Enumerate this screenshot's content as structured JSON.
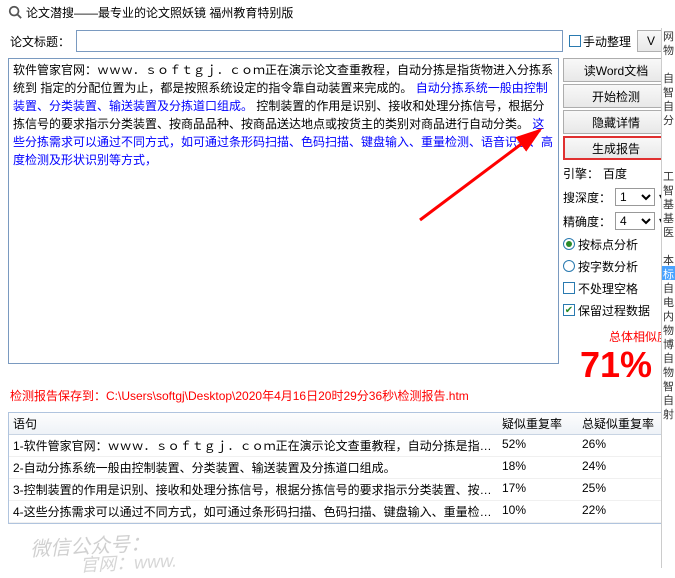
{
  "window": {
    "title": "论文潜搜——最专业的论文照妖镜 福州教育特别版"
  },
  "top": {
    "title_label": "论文标题：",
    "manual_sort": "手动整理",
    "btn_v": "V"
  },
  "content": {
    "line1": "软件管家官网：ｗｗｗ．ｓｏｆｔｇｊ．ｃｏｍ正在演示论文查重教程，自动分拣是指货物进入分拣系统到",
    "line2": "指定的分配位置为止，都是按照系统设定的指令靠自动装置来完成的。",
    "blue1": "自动分拣系统一般由控制装置、分类装置、输送装置及分拣道口组成。",
    "line3": "控制装置的作用是识别、接收和处理分拣信号，根据分拣信号的要求指示分类装置、按商品品种、按商品送达地点或按货主的类别对商品进行自动分类。",
    "blue2": "这些分拣需求可以通过不同方式，如可通过条形码扫描、色码扫描、键盘输入、重量检测、语音识别、高度检测及形状识别等方式，"
  },
  "side": {
    "read_word": "读Word文档",
    "start": "开始检测",
    "hide": "隐藏详情",
    "report": "生成报告",
    "engine_label": "引擎：",
    "engine_val": "百度",
    "depth_label": "搜深度：",
    "depth_val": "1",
    "precision_label": "精确度：",
    "precision_val": "4",
    "by_punct": "按标点分析",
    "by_count": "按字数分析",
    "ignore_space": "不处理空格",
    "keep_data": "保留过程数据",
    "sim_label": "总体相似度",
    "sim_val": "71%"
  },
  "message": "检测报告保存到：C:\\Users\\softgj\\Desktop\\2020年4月16日20时29分36秒\\检测报告.htm",
  "table": {
    "h1": "语句",
    "h2": "疑似重复率",
    "h3": "总疑似重复率",
    "rows": [
      {
        "s": "1-软件管家官网：ｗｗｗ．ｓｏｆｔｇｊ．ｃｏｍ正在演示论文查重教程，自动分拣是指…",
        "r1": "52%",
        "r2": "26%"
      },
      {
        "s": "2-自动分拣系统一般由控制装置、分类装置、输送装置及分拣道口组成。",
        "r1": "18%",
        "r2": "24%"
      },
      {
        "s": "3-控制装置的作用是识别、接收和处理分拣信号，根据分拣信号的要求指示分类装置、按…",
        "r1": "17%",
        "r2": "25%"
      },
      {
        "s": "4-这些分拣需求可以通过不同方式，如可通过条形码扫描、色码扫描、键盘输入、重量检…",
        "r1": "10%",
        "r2": "22%"
      }
    ]
  },
  "strip": [
    "网",
    "物",
    "",
    "自",
    "智",
    "自",
    "分",
    "",
    "",
    "",
    "工",
    "智",
    "基",
    "基",
    "医",
    "",
    "本",
    "标",
    "自",
    "电",
    "内",
    "物",
    "博",
    "自",
    "物",
    "智",
    "自",
    "射"
  ],
  "watermark1": "微信公众号：",
  "watermark2": "官网：www."
}
